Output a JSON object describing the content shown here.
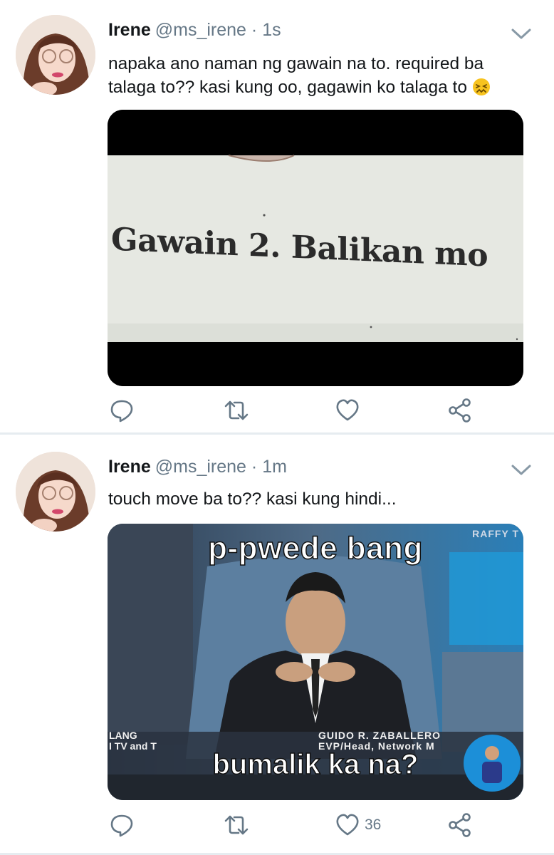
{
  "tweets": [
    {
      "name": "Irene",
      "handle": "@ms_irene",
      "time": "· 1s",
      "text": "napaka ano naman ng gawain na to. required ba talaga to?? kasi kung oo, gagawin ko talaga to",
      "emoji": "confounded-face",
      "media": {
        "paper_text": "Gawain 2. Balikan mo"
      },
      "actions": {
        "like_count": ""
      }
    },
    {
      "name": "Irene",
      "handle": "@ms_irene",
      "time": "· 1m",
      "text": "touch move ba to?? kasi kung hindi...",
      "media": {
        "caption_top": "p-pwede bang",
        "caption_bottom": "bumalik ka na?",
        "watermark": "RAFFY T",
        "lower_third_left_1": "LANG",
        "lower_third_left_2": "I TV and T",
        "lower_third_right_1": "GUIDO R. ZABALLERO",
        "lower_third_right_2": "EVP/Head, Network M"
      },
      "actions": {
        "like_count": "36"
      }
    }
  ],
  "colors": {
    "text": "#14171a",
    "secondary": "#657786",
    "divider": "#e6ecf0",
    "emoji": "#f7c31f"
  }
}
